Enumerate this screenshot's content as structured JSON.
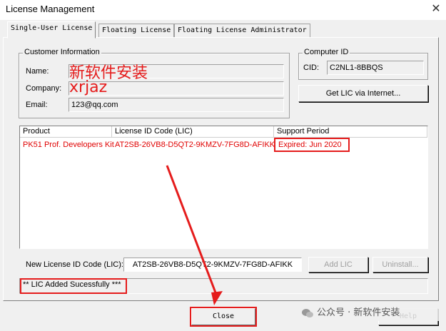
{
  "window": {
    "title": "License Management",
    "close_glyph": "✕"
  },
  "tabs": [
    {
      "label": "Single-User License"
    },
    {
      "label": "Floating License"
    },
    {
      "label": "Floating License Administrator"
    }
  ],
  "customer": {
    "legend": "Customer Information",
    "name_label": "Name:",
    "name_value": "",
    "company_label": "Company:",
    "company_value": "",
    "email_label": "Email:",
    "email_value": "123@qq.com"
  },
  "overlay": {
    "name_text": "新软件安装",
    "company_text": "xrjaz"
  },
  "computer": {
    "legend": "Computer ID",
    "cid_label": "CID:",
    "cid_value": "C2NL1-8BBQS",
    "get_lic_button": "Get LIC via Internet..."
  },
  "table": {
    "headers": [
      "Product",
      "License ID Code (LIC)",
      "Support Period"
    ],
    "rows": [
      {
        "product": "PK51 Prof. Developers Kit",
        "lic": "AT2SB-26VB8-D5QT2-9KMZV-7FG8D-AFIKK",
        "support": "Expired: Jun 2020"
      }
    ]
  },
  "new_lic": {
    "label": "New License ID Code (LIC):",
    "value": "AT2SB-26VB8-D5QT2-9KMZV-7FG8D-AFIKK",
    "add_button": "Add LIC",
    "uninstall_button": "Uninstall..."
  },
  "status": {
    "message": "** LIC Added Sucessfully ***"
  },
  "footer": {
    "close_button": "Close",
    "help_button": "Help"
  },
  "watermark": {
    "text": "公众号 · 新软件安装"
  },
  "colors": {
    "annotation_red": "#e51c1c",
    "red_text": "#e00000"
  }
}
